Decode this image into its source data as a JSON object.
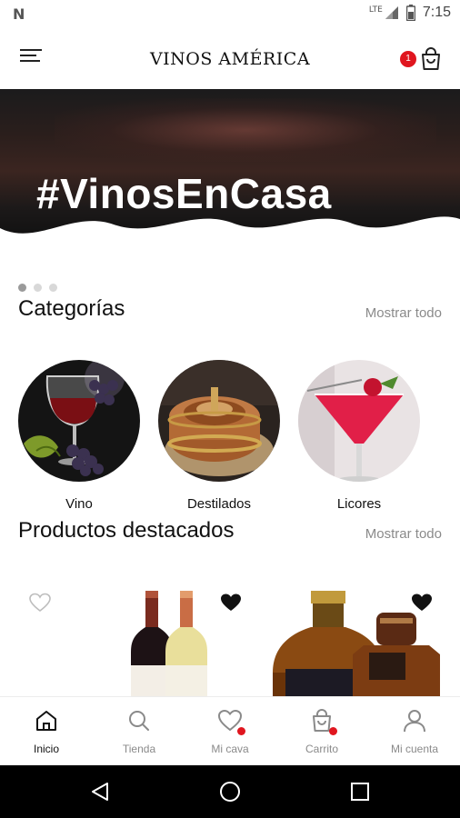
{
  "status_bar": {
    "left_icon": "N",
    "network": "LTE",
    "time": "7:15"
  },
  "header": {
    "brand": "VINOS AMÉRICA",
    "cart_count": "1",
    "icons": [
      "menu-icon",
      "cart-icon"
    ]
  },
  "banner": {
    "text": "#VinosEnCasa"
  },
  "carousel": {
    "count": 3,
    "active_index": 0
  },
  "categories": {
    "title": "Categorías",
    "show_all": "Mostrar todo",
    "items": [
      {
        "label": "Vino"
      },
      {
        "label": "Destilados"
      },
      {
        "label": "Licores"
      }
    ]
  },
  "featured": {
    "title": "Productos destacados",
    "show_all": "Mostrar todo",
    "products": [
      {
        "favorite": false
      },
      {
        "favorite": true
      },
      {
        "favorite": true
      }
    ]
  },
  "bottom_nav": {
    "items": [
      {
        "label": "Inicio",
        "icon": "home-icon",
        "active": true
      },
      {
        "label": "Tienda",
        "icon": "search-icon",
        "active": false
      },
      {
        "label": "Mi cava",
        "icon": "heart-icon",
        "active": false
      },
      {
        "label": "Carrito",
        "icon": "cart-icon",
        "active": false
      },
      {
        "label": "Mi cuenta",
        "icon": "user-icon",
        "active": false
      }
    ]
  },
  "colors": {
    "accent_red": "#e0161f",
    "text_primary": "#111111",
    "text_muted": "#8a8a8a"
  }
}
